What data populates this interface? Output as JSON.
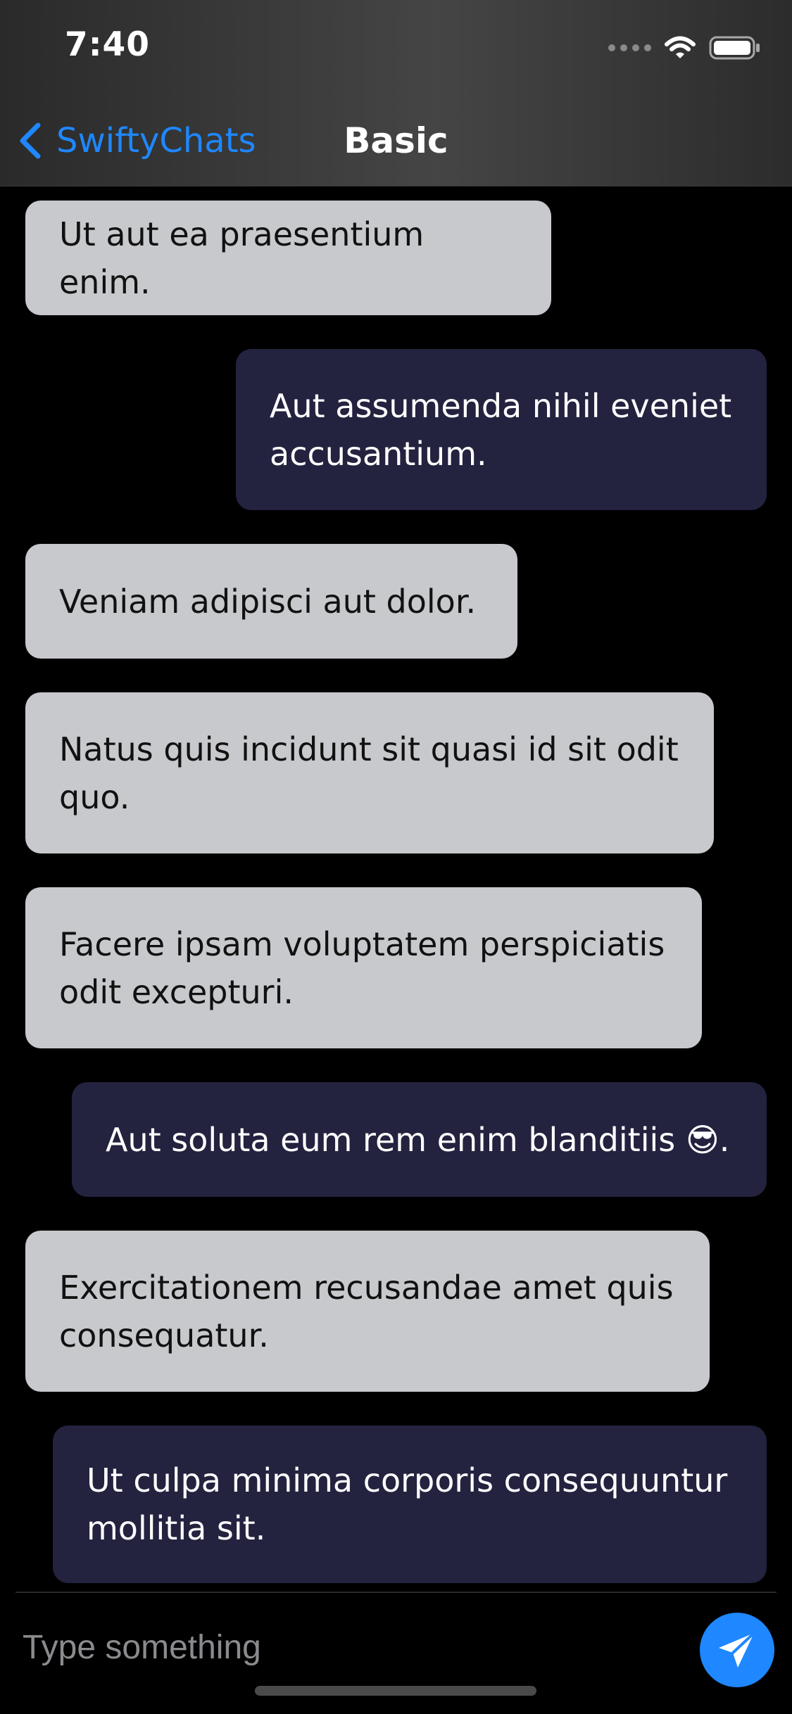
{
  "status_bar": {
    "time": "7:40",
    "signal_icon": "signal-dots-icon",
    "wifi_icon": "wifi-icon",
    "battery_icon": "battery-icon"
  },
  "nav": {
    "back_label": "SwiftyChats",
    "back_icon": "chevron-left-icon",
    "title": "Basic",
    "accent_color": "#1f87ff"
  },
  "messages": [
    {
      "sender": "incoming",
      "text": "Ut aut ea praesentium enim."
    },
    {
      "sender": "outgoing",
      "text": "Aut assumenda nihil eveniet accusantium."
    },
    {
      "sender": "incoming",
      "text": "Veniam adipisci aut dolor."
    },
    {
      "sender": "incoming",
      "text": "Natus quis incidunt sit quasi id sit odit quo."
    },
    {
      "sender": "incoming",
      "text": "Facere ipsam voluptatem perspiciatis odit excepturi."
    },
    {
      "sender": "outgoing",
      "text": "Aut soluta eum rem enim blanditiis 😎."
    },
    {
      "sender": "incoming",
      "text": "Exercitationem recusandae amet quis consequatur."
    },
    {
      "sender": "outgoing",
      "text": "Ut culpa minima corporis consequuntur mollitia sit."
    }
  ],
  "colors": {
    "incoming_bubble": "#c8c9cd",
    "outgoing_bubble": "#23223f",
    "background": "#000000"
  },
  "composer": {
    "placeholder": "Type something",
    "value": "",
    "send_icon": "paper-plane-icon"
  }
}
